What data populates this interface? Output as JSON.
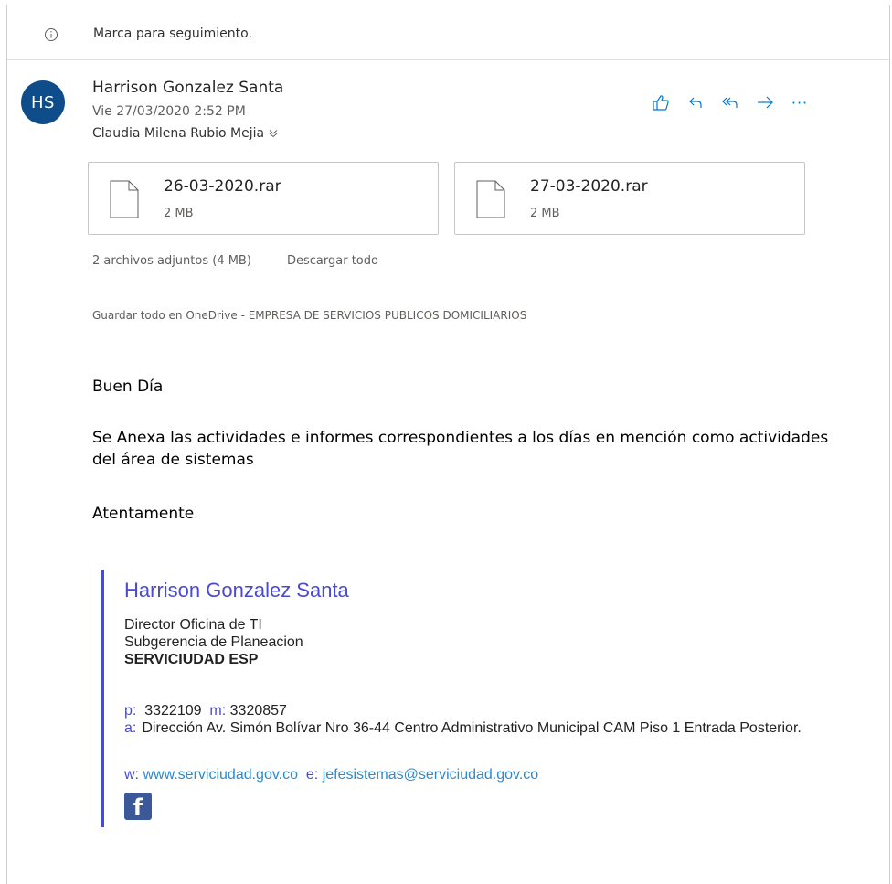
{
  "flag": {
    "text": "Marca para seguimiento."
  },
  "header": {
    "avatar_initials": "HS",
    "sender": "Harrison Gonzalez Santa",
    "date": "Vie 27/03/2020 2:52 PM",
    "recipient": "Claudia Milena Rubio Mejia"
  },
  "actions": {
    "like": "thumbs-up-icon",
    "reply": "reply-icon",
    "reply_all": "reply-all-icon",
    "forward": "forward-icon",
    "more": "···"
  },
  "attachments": [
    {
      "name": "26-03-2020.rar",
      "size": "2 MB"
    },
    {
      "name": "27-03-2020.rar",
      "size": "2 MB"
    }
  ],
  "attachments_summary": "2 archivos adjuntos (4 MB)",
  "download_all": "Descargar todo",
  "save_onedrive": "Guardar todo en OneDrive - EMPRESA DE SERVICIOS PUBLICOS DOMICILIARIOS",
  "body": {
    "greeting": "Buen Día",
    "paragraph": "Se Anexa las actividades e informes correspondientes a los días en mención como actividades del área de sistemas",
    "closing": "Atentamente"
  },
  "signature": {
    "name": "Harrison Gonzalez Santa",
    "role": "Director Oficina de TI",
    "department": "Subgerencia de Planeacion",
    "company": "SERVICIUDAD ESP",
    "phone_label": "p:",
    "phone": "3322109",
    "mobile_label": "m:",
    "mobile": "3320857",
    "address_label": "a:",
    "address": "Dirección Av. Simón Bolívar Nro 36-44 Centro Administrativo Municipal CAM Piso 1 Entrada Posterior.",
    "web_label": "w:",
    "web": "www.serviciudad.gov.co",
    "email_label": "e:",
    "email": "jefesistemas@serviciudad.gov.co",
    "facebook": "f"
  },
  "colors": {
    "accent": "#0078d4",
    "avatar": "#0f4d8a",
    "signature_accent": "#4a4acf",
    "link": "#2b8ad1",
    "facebook": "#3b5998"
  }
}
